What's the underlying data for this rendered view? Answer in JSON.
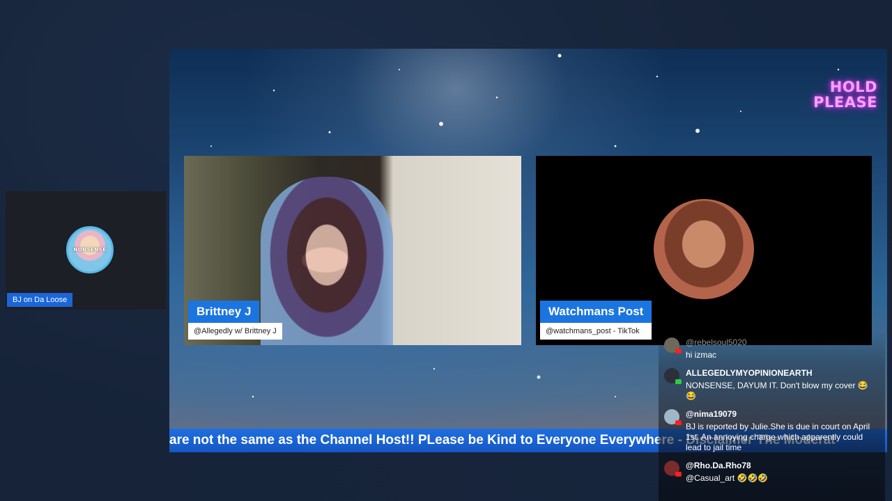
{
  "side_guest": {
    "name": "BJ on Da Loose",
    "avatar_text": "NONSENSE"
  },
  "stage": {
    "hold_line1": "HOLD",
    "hold_line2": "PLEASE",
    "guest1": {
      "name": "Brittney J",
      "handle": "@Allegedly w/ Brittney J"
    },
    "guest2": {
      "name": "Watchmans Post",
      "handle": "@watchmans_post - TikTok"
    },
    "ticker": "are not the same as the Channel Host!! PLease be Kind to Everyone Everywhere - Disclaimer The Moderat"
  },
  "chat": [
    {
      "user": "@rebelsoul5020",
      "message": "hi izmac",
      "avatar_color": "#6d6a5c",
      "dim": true
    },
    {
      "user": "ALLEGEDLYMYOPINIONEARTH",
      "message": "NONSENSE, DAYUM IT. Don't blow my cover 😂😂",
      "avatar_color": "#2a2f3a",
      "dim": false
    },
    {
      "user": "@nima19079",
      "message": "BJ is reported by Julie.She is due in court on April 1st. An annoying charge which apparently could lead to jail time",
      "avatar_color": "#9fb7c7",
      "dim": false
    },
    {
      "user": "@Rho.Da.Rho78",
      "message": "@Casual_art 🤣🤣🤣",
      "avatar_color": "#7a2b2b",
      "dim": false
    }
  ]
}
